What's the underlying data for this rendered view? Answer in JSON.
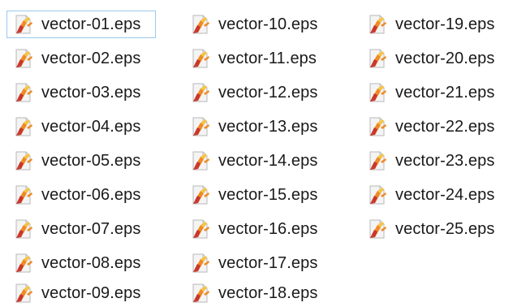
{
  "files": [
    {
      "name": "vector-01.eps",
      "icon": "eps-file-icon",
      "focused": true
    },
    {
      "name": "vector-02.eps",
      "icon": "eps-file-icon"
    },
    {
      "name": "vector-03.eps",
      "icon": "eps-file-icon"
    },
    {
      "name": "vector-04.eps",
      "icon": "eps-file-icon"
    },
    {
      "name": "vector-05.eps",
      "icon": "eps-file-icon"
    },
    {
      "name": "vector-06.eps",
      "icon": "eps-file-icon"
    },
    {
      "name": "vector-07.eps",
      "icon": "eps-file-icon"
    },
    {
      "name": "vector-08.eps",
      "icon": "eps-file-icon"
    },
    {
      "name": "vector-09.eps",
      "icon": "eps-file-icon"
    },
    {
      "name": "vector-10.eps",
      "icon": "eps-file-icon"
    },
    {
      "name": "vector-11.eps",
      "icon": "eps-file-icon"
    },
    {
      "name": "vector-12.eps",
      "icon": "eps-file-icon"
    },
    {
      "name": "vector-13.eps",
      "icon": "eps-file-icon"
    },
    {
      "name": "vector-14.eps",
      "icon": "eps-file-icon"
    },
    {
      "name": "vector-15.eps",
      "icon": "eps-file-icon"
    },
    {
      "name": "vector-16.eps",
      "icon": "eps-file-icon"
    },
    {
      "name": "vector-17.eps",
      "icon": "eps-file-icon"
    },
    {
      "name": "vector-18.eps",
      "icon": "eps-file-icon"
    },
    {
      "name": "vector-19.eps",
      "icon": "eps-file-icon"
    },
    {
      "name": "vector-20.eps",
      "icon": "eps-file-icon"
    },
    {
      "name": "vector-21.eps",
      "icon": "eps-file-icon"
    },
    {
      "name": "vector-22.eps",
      "icon": "eps-file-icon"
    },
    {
      "name": "vector-23.eps",
      "icon": "eps-file-icon"
    },
    {
      "name": "vector-24.eps",
      "icon": "eps-file-icon"
    },
    {
      "name": "vector-25.eps",
      "icon": "eps-file-icon"
    }
  ],
  "colors": {
    "focus_border": "#99c9ef",
    "text": "#1a1a1a",
    "icon_page": "#f4f4f4",
    "icon_nib_red": "#c8372d",
    "icon_nib_orange": "#f08a24",
    "icon_nib_yellow": "#f6c343"
  }
}
